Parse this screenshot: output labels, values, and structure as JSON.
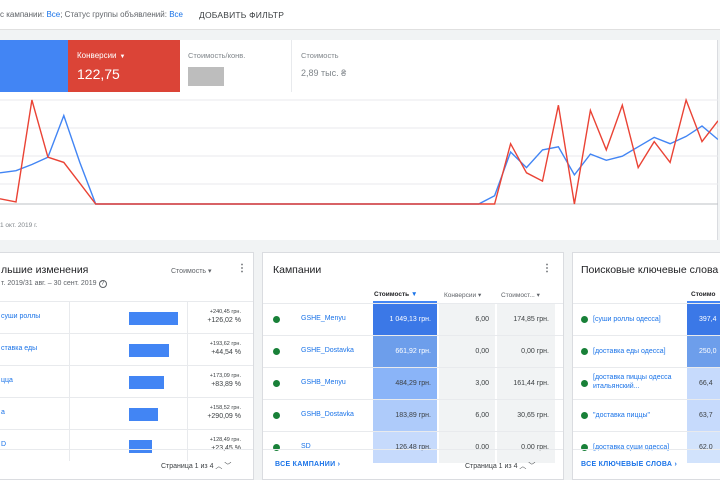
{
  "filter_bar": {
    "campaign_filter_label": "с кампании: ",
    "campaign_filter_value": "Все",
    "adgroup_filter_label": "; Статус группы объявлений: ",
    "adgroup_filter_value": "Все",
    "add_filter_label": "ДОБАВИТЬ ФИЛЬТР"
  },
  "metrics": {
    "conversions": {
      "label": "Конверсии",
      "value": "122,75",
      "color": "#db4437"
    },
    "cost_per_conv": {
      "label": "Стоимость/конв."
    },
    "cost": {
      "label": "Стоимость",
      "value": "2,89 тыс. ₴"
    },
    "primary_color": "#4285f4"
  },
  "chart_data": {
    "type": "line",
    "x_start_label": "1 окт. 2019 г.",
    "series": [
      {
        "color": "#4285f4",
        "values": [
          30,
          32,
          38,
          45,
          85,
          40,
          0,
          0,
          0,
          0,
          0,
          0,
          0,
          0,
          0,
          0,
          0,
          0,
          0,
          0,
          0,
          0,
          0,
          0,
          0,
          0,
          0,
          0,
          0,
          0,
          0,
          8,
          50,
          35,
          52,
          55,
          28,
          48,
          42,
          46,
          55,
          64,
          58,
          65,
          75,
          62
        ]
      },
      {
        "color": "#ea4335",
        "values": [
          5,
          2,
          100,
          45,
          40,
          20,
          0,
          0,
          0,
          0,
          0,
          0,
          0,
          0,
          0,
          0,
          0,
          0,
          0,
          0,
          0,
          0,
          0,
          0,
          0,
          0,
          0,
          0,
          0,
          0,
          0,
          0,
          58,
          30,
          22,
          95,
          0,
          90,
          52,
          95,
          35,
          60,
          40,
          100,
          60,
          80
        ]
      }
    ]
  },
  "changes_card": {
    "title": "льшие изменения",
    "subtitle": "т. 2019/31 авг. – 30 сент. 2019",
    "sort_label": "Стоимость",
    "rows": [
      {
        "name": "суши роллы",
        "abs": "+240,45 грн.",
        "pct": "+126,02 %",
        "bar": 0.98
      },
      {
        "name": "ставка еды",
        "abs": "+193,62 грн.",
        "pct": "+44,54 %",
        "bar": 0.8
      },
      {
        "name": "цца",
        "abs": "+173,09 грн.",
        "pct": "+83,89 %",
        "bar": 0.7
      },
      {
        "name": "а",
        "abs": "+158,52 грн.",
        "pct": "+290,09 %",
        "bar": 0.58
      },
      {
        "name": "D",
        "abs": "+128,49 грн.",
        "pct": "+23,45 %",
        "bar": 0.45
      }
    ],
    "pager": "Страница 1 из 4"
  },
  "campaigns_card": {
    "title": "Кампании",
    "headers": {
      "cost": "Стоимость",
      "conv": "Конверсии",
      "cpc": "Стоимост..."
    },
    "rows": [
      {
        "name": "GSHE_Menyu",
        "cost": "1 049,13 грн.",
        "conv": "6,00",
        "cpc": "174,85 грн.",
        "cost_color": "#3b78e7",
        "cost_text": "#ffffff"
      },
      {
        "name": "GSHE_Dostavka",
        "cost": "661,92 грн.",
        "conv": "0,00",
        "cpc": "0,00 грн.",
        "cost_color": "#6d9eeb",
        "cost_text": "#ffffff"
      },
      {
        "name": "GSHB_Menyu",
        "cost": "484,29 грн.",
        "conv": "3,00",
        "cpc": "161,44 грн.",
        "cost_color": "#8ab4f8",
        "cost_text": "#3c4043"
      },
      {
        "name": "GSHB_Dostavka",
        "cost": "183,89 грн.",
        "conv": "6,00",
        "cpc": "30,65 грн.",
        "cost_color": "#aecbfa",
        "cost_text": "#3c4043"
      },
      {
        "name": "SD",
        "cost": "126,48 грн.",
        "conv": "0,00",
        "cpc": "0,00 грн.",
        "cost_color": "#c6dafc",
        "cost_text": "#3c4043"
      }
    ],
    "all_label": "ВСЕ КАМПАНИИ",
    "pager": "Страница 1 из 4"
  },
  "keywords_card": {
    "title": "Поисковые ключевые слова",
    "header": "Стоимо",
    "rows": [
      {
        "name": "[суши роллы одесса]",
        "value": "397,4",
        "color": "#3b78e7",
        "text": "#ffffff"
      },
      {
        "name": "[доставка еды одесса]",
        "value": "250,0",
        "color": "#6d9eeb",
        "text": "#ffffff"
      },
      {
        "name": "[доставка пиццы одесса итальянский...",
        "value": "66,4",
        "color": "#c6dafc",
        "text": "#3c4043"
      },
      {
        "name": "\"доставка пиццы\"",
        "value": "63,7",
        "color": "#c6dafc",
        "text": "#3c4043"
      },
      {
        "name": "[доставка суши одесса]",
        "value": "62,0",
        "color": "#d2e3fc",
        "text": "#3c4043"
      }
    ],
    "all_label": "ВСЕ КЛЮЧЕВЫЕ СЛОВА"
  }
}
